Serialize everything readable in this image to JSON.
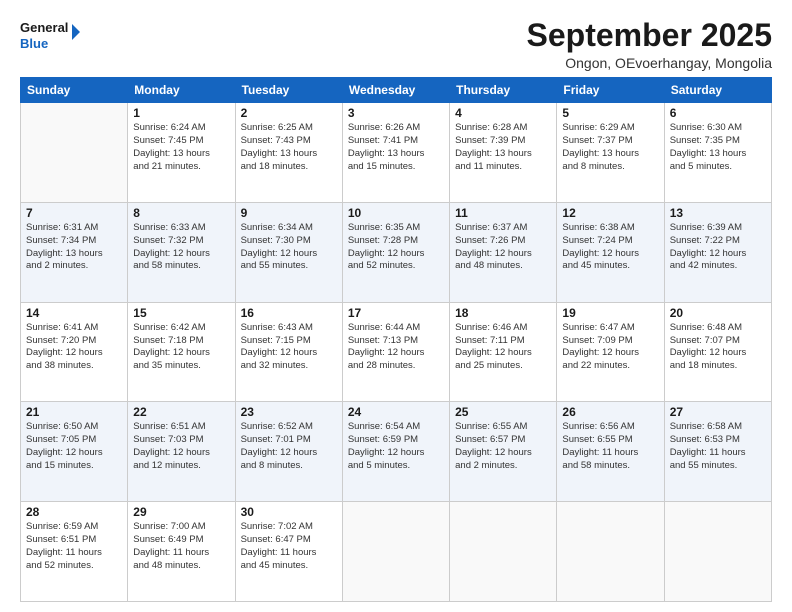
{
  "logo": {
    "line1": "General",
    "line2": "Blue"
  },
  "title": "September 2025",
  "subtitle": "Ongon, OEvoerhangay, Mongolia",
  "weekdays": [
    "Sunday",
    "Monday",
    "Tuesday",
    "Wednesday",
    "Thursday",
    "Friday",
    "Saturday"
  ],
  "weeks": [
    [
      {
        "day": "",
        "info": ""
      },
      {
        "day": "1",
        "info": "Sunrise: 6:24 AM\nSunset: 7:45 PM\nDaylight: 13 hours\nand 21 minutes."
      },
      {
        "day": "2",
        "info": "Sunrise: 6:25 AM\nSunset: 7:43 PM\nDaylight: 13 hours\nand 18 minutes."
      },
      {
        "day": "3",
        "info": "Sunrise: 6:26 AM\nSunset: 7:41 PM\nDaylight: 13 hours\nand 15 minutes."
      },
      {
        "day": "4",
        "info": "Sunrise: 6:28 AM\nSunset: 7:39 PM\nDaylight: 13 hours\nand 11 minutes."
      },
      {
        "day": "5",
        "info": "Sunrise: 6:29 AM\nSunset: 7:37 PM\nDaylight: 13 hours\nand 8 minutes."
      },
      {
        "day": "6",
        "info": "Sunrise: 6:30 AM\nSunset: 7:35 PM\nDaylight: 13 hours\nand 5 minutes."
      }
    ],
    [
      {
        "day": "7",
        "info": "Sunrise: 6:31 AM\nSunset: 7:34 PM\nDaylight: 13 hours\nand 2 minutes."
      },
      {
        "day": "8",
        "info": "Sunrise: 6:33 AM\nSunset: 7:32 PM\nDaylight: 12 hours\nand 58 minutes."
      },
      {
        "day": "9",
        "info": "Sunrise: 6:34 AM\nSunset: 7:30 PM\nDaylight: 12 hours\nand 55 minutes."
      },
      {
        "day": "10",
        "info": "Sunrise: 6:35 AM\nSunset: 7:28 PM\nDaylight: 12 hours\nand 52 minutes."
      },
      {
        "day": "11",
        "info": "Sunrise: 6:37 AM\nSunset: 7:26 PM\nDaylight: 12 hours\nand 48 minutes."
      },
      {
        "day": "12",
        "info": "Sunrise: 6:38 AM\nSunset: 7:24 PM\nDaylight: 12 hours\nand 45 minutes."
      },
      {
        "day": "13",
        "info": "Sunrise: 6:39 AM\nSunset: 7:22 PM\nDaylight: 12 hours\nand 42 minutes."
      }
    ],
    [
      {
        "day": "14",
        "info": "Sunrise: 6:41 AM\nSunset: 7:20 PM\nDaylight: 12 hours\nand 38 minutes."
      },
      {
        "day": "15",
        "info": "Sunrise: 6:42 AM\nSunset: 7:18 PM\nDaylight: 12 hours\nand 35 minutes."
      },
      {
        "day": "16",
        "info": "Sunrise: 6:43 AM\nSunset: 7:15 PM\nDaylight: 12 hours\nand 32 minutes."
      },
      {
        "day": "17",
        "info": "Sunrise: 6:44 AM\nSunset: 7:13 PM\nDaylight: 12 hours\nand 28 minutes."
      },
      {
        "day": "18",
        "info": "Sunrise: 6:46 AM\nSunset: 7:11 PM\nDaylight: 12 hours\nand 25 minutes."
      },
      {
        "day": "19",
        "info": "Sunrise: 6:47 AM\nSunset: 7:09 PM\nDaylight: 12 hours\nand 22 minutes."
      },
      {
        "day": "20",
        "info": "Sunrise: 6:48 AM\nSunset: 7:07 PM\nDaylight: 12 hours\nand 18 minutes."
      }
    ],
    [
      {
        "day": "21",
        "info": "Sunrise: 6:50 AM\nSunset: 7:05 PM\nDaylight: 12 hours\nand 15 minutes."
      },
      {
        "day": "22",
        "info": "Sunrise: 6:51 AM\nSunset: 7:03 PM\nDaylight: 12 hours\nand 12 minutes."
      },
      {
        "day": "23",
        "info": "Sunrise: 6:52 AM\nSunset: 7:01 PM\nDaylight: 12 hours\nand 8 minutes."
      },
      {
        "day": "24",
        "info": "Sunrise: 6:54 AM\nSunset: 6:59 PM\nDaylight: 12 hours\nand 5 minutes."
      },
      {
        "day": "25",
        "info": "Sunrise: 6:55 AM\nSunset: 6:57 PM\nDaylight: 12 hours\nand 2 minutes."
      },
      {
        "day": "26",
        "info": "Sunrise: 6:56 AM\nSunset: 6:55 PM\nDaylight: 11 hours\nand 58 minutes."
      },
      {
        "day": "27",
        "info": "Sunrise: 6:58 AM\nSunset: 6:53 PM\nDaylight: 11 hours\nand 55 minutes."
      }
    ],
    [
      {
        "day": "28",
        "info": "Sunrise: 6:59 AM\nSunset: 6:51 PM\nDaylight: 11 hours\nand 52 minutes."
      },
      {
        "day": "29",
        "info": "Sunrise: 7:00 AM\nSunset: 6:49 PM\nDaylight: 11 hours\nand 48 minutes."
      },
      {
        "day": "30",
        "info": "Sunrise: 7:02 AM\nSunset: 6:47 PM\nDaylight: 11 hours\nand 45 minutes."
      },
      {
        "day": "",
        "info": ""
      },
      {
        "day": "",
        "info": ""
      },
      {
        "day": "",
        "info": ""
      },
      {
        "day": "",
        "info": ""
      }
    ]
  ]
}
